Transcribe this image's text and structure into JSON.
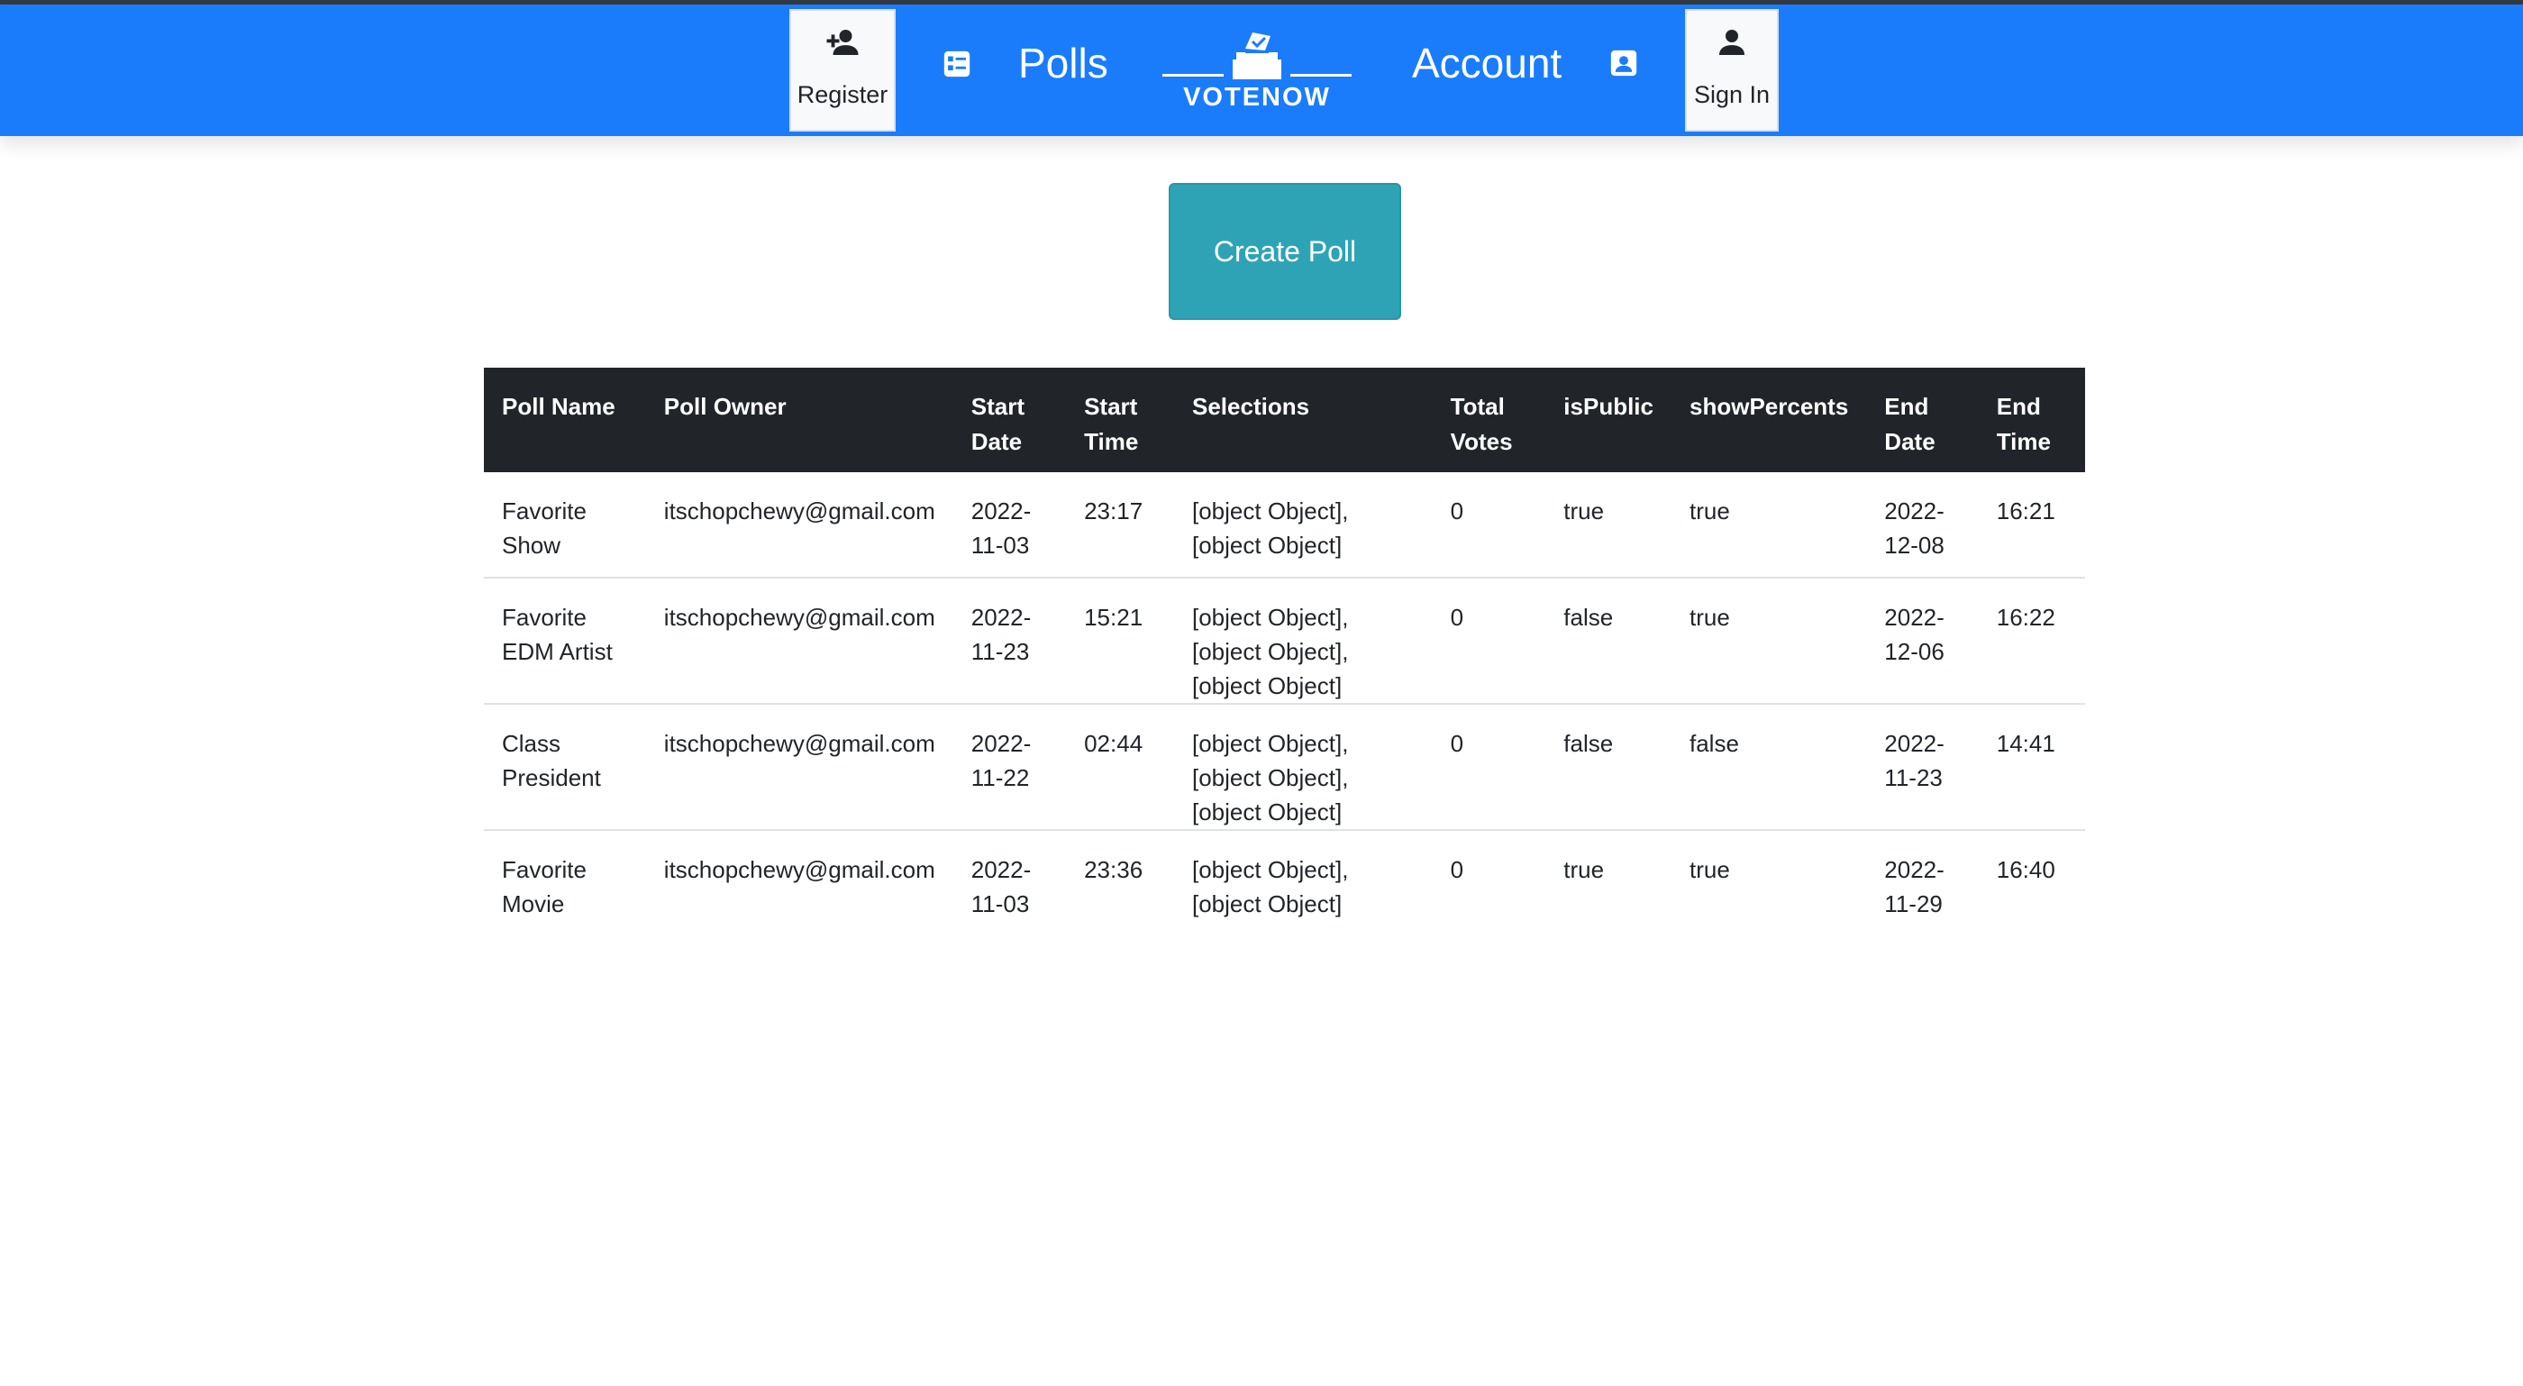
{
  "nav": {
    "register_label": "Register",
    "polls_label": "Polls",
    "brand_label": "VOTENOW",
    "account_label": "Account",
    "signin_label": "Sign In",
    "icons": {
      "register": "person-add-icon",
      "polls": "list-icon",
      "brand": "ballot-box-icon",
      "account": "contact-card-icon",
      "signin": "person-icon"
    },
    "colors": {
      "navbar": "#1a7cfb",
      "card": "#f8f9fa"
    }
  },
  "main": {
    "create_poll_label": "Create Poll",
    "create_poll_color": "#2fa3b6"
  },
  "table": {
    "columns": [
      "Poll Name",
      "Poll Owner",
      "Start Date",
      "Start Time",
      "Selections",
      "Total Votes",
      "isPublic",
      "showPercents",
      "End Date",
      "End Time"
    ],
    "rows": [
      [
        "Favorite Show",
        "itschopchewy@gmail.com",
        "2022-11-03",
        "23:17",
        "[object Object],[object Object]",
        "0",
        "true",
        "true",
        "2022-12-08",
        "16:21"
      ],
      [
        "Favorite EDM Artist",
        "itschopchewy@gmail.com",
        "2022-11-23",
        "15:21",
        "[object Object],[object Object],[object Object]",
        "0",
        "false",
        "true",
        "2022-12-06",
        "16:22"
      ],
      [
        "Class President",
        "itschopchewy@gmail.com",
        "2022-11-22",
        "02:44",
        "[object Object],[object Object],[object Object]",
        "0",
        "false",
        "false",
        "2022-11-23",
        "14:41"
      ],
      [
        "Favorite Movie",
        "itschopchewy@gmail.com",
        "2022-11-03",
        "23:36",
        "[object Object],[object Object]",
        "0",
        "true",
        "true",
        "2022-11-29",
        "16:40"
      ]
    ],
    "header_color": "#212529"
  }
}
